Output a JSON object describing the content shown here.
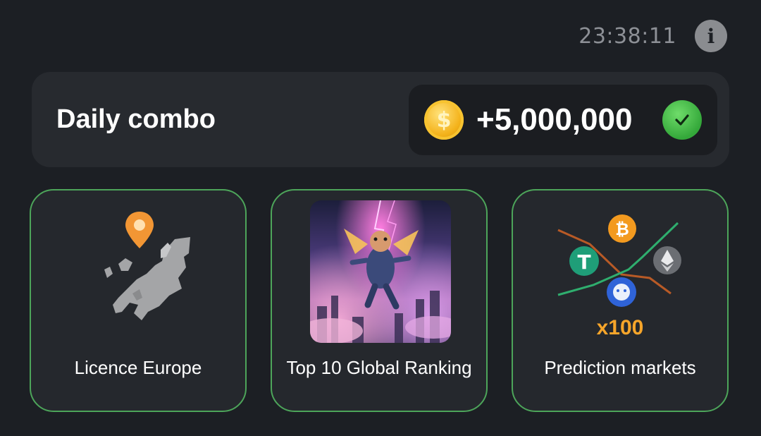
{
  "header": {
    "timer": "23:38:11",
    "info_icon": "info-icon"
  },
  "combo": {
    "title": "Daily combo",
    "reward": "+5,000,000",
    "coin_symbol": "$",
    "status": "complete"
  },
  "cards": [
    {
      "label": "Licence Europe",
      "image": "europe-map-with-pin"
    },
    {
      "label": "Top 10 Global Ranking",
      "image": "flying-hamster-astronaut"
    },
    {
      "label": "Prediction markets",
      "image": "crypto-prediction-graph",
      "multiplier": "x100"
    }
  ],
  "colors": {
    "background": "#1c1f24",
    "panel": "#272a2f",
    "card_border": "#4da55a",
    "accent_orange": "#f6a52a",
    "coin_gold": "#f4b21a",
    "check_green": "#34a83a"
  }
}
